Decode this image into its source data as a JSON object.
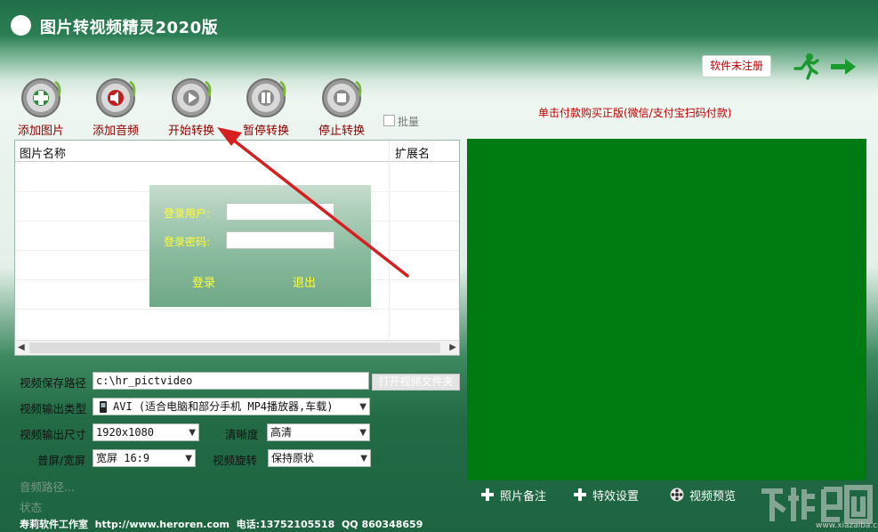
{
  "window": {
    "title": "图片转视频精灵2020版"
  },
  "header": {
    "register_label": "软件未注册"
  },
  "toolbar": {
    "items": [
      {
        "label": "添加图片",
        "icon": "add-image-icon"
      },
      {
        "label": "添加音频",
        "icon": "add-audio-icon"
      },
      {
        "label": "开始转换",
        "icon": "play-icon"
      },
      {
        "label": "暂停转换",
        "icon": "pause-icon"
      },
      {
        "label": "停止转换",
        "icon": "stop-icon"
      }
    ],
    "batch_label": "批量",
    "batch_checked": false
  },
  "buy_link": "单击付款购买正版(微信/支付宝扫码付款)",
  "file_list": {
    "columns": [
      "图片名称",
      "扩展名"
    ],
    "rows": []
  },
  "login": {
    "user_label": "登录用户:",
    "password_label": "登录密码:",
    "user_value": "",
    "password_value": "",
    "login_button": "登录",
    "exit_button": "退出"
  },
  "settings": {
    "save_path_label": "视频保存路径",
    "save_path_value": "c:\\hr_pictvideo",
    "open_folder_button": "打开视频文件夹",
    "output_type_label": "视频输出类型",
    "output_type_value": "AVI (适合电脑和部分手机 MP4播放器,车载)",
    "output_size_label": "视频输出尺寸",
    "output_size_value": "1920x1080",
    "clarity_label": "清晰度",
    "clarity_value": "高清",
    "screen_label": "普屏/宽屏",
    "screen_value": "宽屏 16:9",
    "rotate_label": "视频旋转",
    "rotate_value": "保持原状",
    "audio_path_label": "音频路径...",
    "status_label": "状态"
  },
  "preview_controls": {
    "photo_note": "照片备注",
    "effects": "特效设置",
    "preview": "视频预览"
  },
  "footer": {
    "studio": "寿莉软件工作室",
    "website": "http://www.heroren.com",
    "phone": "电话:13752105518",
    "qq": "QQ 860348659"
  },
  "watermark": {
    "text": "www.xiazaiba.com"
  },
  "colors": {
    "accent_red": "#c00000",
    "preview_green": "#007a12",
    "login_yellow": "#ffff33",
    "arrow_red": "#d62020"
  }
}
